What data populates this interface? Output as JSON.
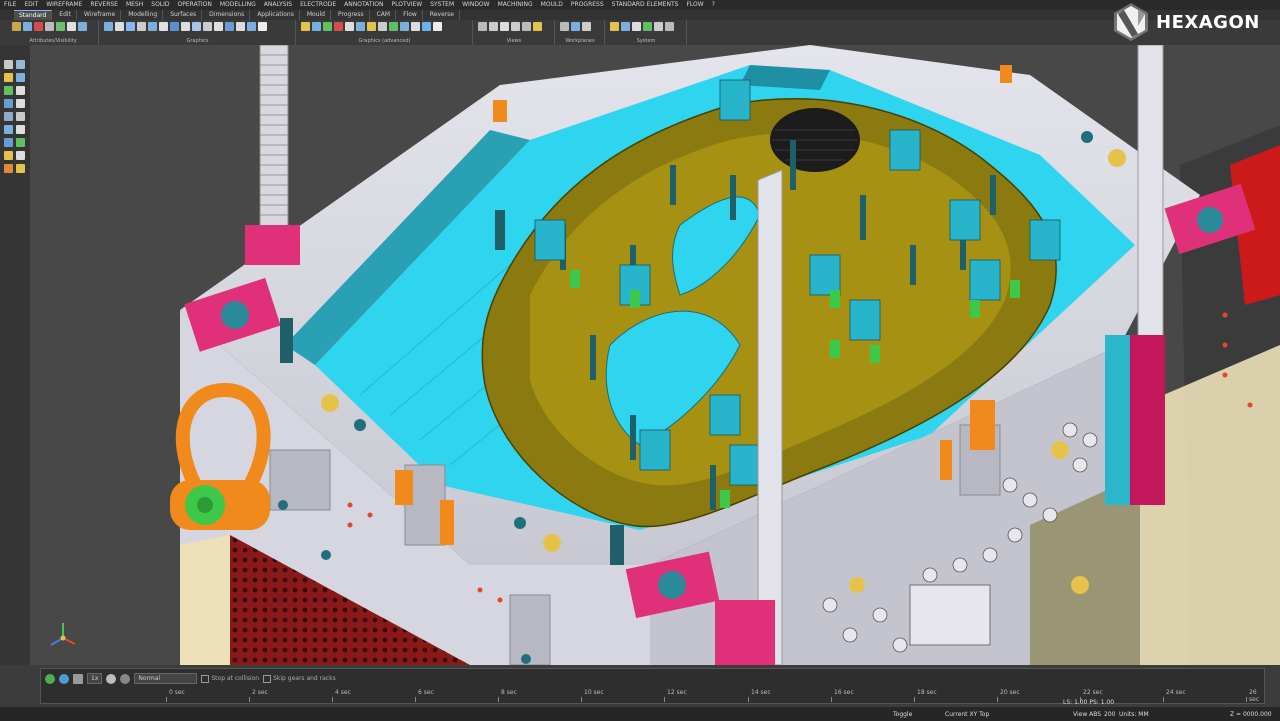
{
  "menu": [
    "FILE",
    "EDIT",
    "WIREFRAME",
    "REVERSE",
    "MESH",
    "SOLID",
    "OPERATION",
    "MODELLING",
    "ANALYSIS",
    "ELECTRODE",
    "ANNOTATION",
    "PLOTVIEW",
    "SYSTEM",
    "WINDOW",
    "MACHINING",
    "MOULD",
    "PROGRESS",
    "STANDARD ELEMENTS",
    "FLOW",
    "?"
  ],
  "tabs": [
    "Standard",
    "Edit",
    "Wireframe",
    "Modelling",
    "Surfaces",
    "Dimensions",
    "Applications",
    "Mould",
    "Progress",
    "CAM",
    "Flow",
    "Reverse"
  ],
  "active_tab": "Standard",
  "ribbon_groups": [
    "Attributes/Visibility",
    "Graphics",
    "Graphics (advanced)",
    "Views",
    "Workplanes",
    "System"
  ],
  "logo": {
    "brand": "HEXAGON"
  },
  "timeline": {
    "speed": "1x",
    "mode": "Normal",
    "checkbox1": "Stop at collision",
    "checkbox2": "Skip gears and racks",
    "ticks": [
      "0 sec",
      "2 sec",
      "4 sec",
      "6 sec",
      "8 sec",
      "10 sec",
      "12 sec",
      "14 sec",
      "16 sec",
      "18 sec",
      "20 sec",
      "22 sec",
      "24 sec",
      "26 sec"
    ]
  },
  "status": {
    "toggle": "Toggle",
    "plane": "Current XY Top",
    "view": "View ABS",
    "view_value": "200",
    "scale": "LS: 1.00 PS: 1.00",
    "units": "Units: MM",
    "coord": "Z = 0000.000"
  }
}
